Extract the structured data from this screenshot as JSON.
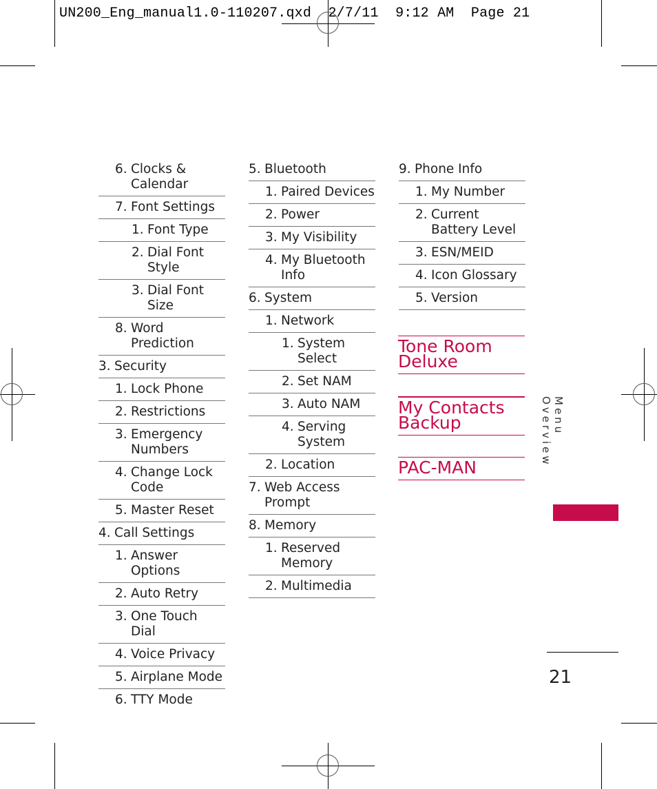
{
  "print_slug": "UN200_Eng_manual1.0-110207.qxd  2/7/11  9:12 AM  Page 21",
  "columns": [
    {
      "rows": [
        {
          "level": 1,
          "num": "6.",
          "text": "Clocks & Calendar"
        },
        {
          "level": 1,
          "num": "7.",
          "text": "Font Settings"
        },
        {
          "level": 2,
          "num": "1.",
          "text": "Font Type"
        },
        {
          "level": 2,
          "num": "2.",
          "text": "Dial Font Style"
        },
        {
          "level": 2,
          "num": "3.",
          "text": "Dial Font Size"
        },
        {
          "level": 1,
          "num": "8.",
          "text": "Word Prediction"
        },
        {
          "level": 0,
          "num": "3.",
          "text": "Security"
        },
        {
          "level": 1,
          "num": "1.",
          "text": "Lock Phone"
        },
        {
          "level": 1,
          "num": "2.",
          "text": "Restrictions"
        },
        {
          "level": 1,
          "num": "3.",
          "text": "Emergency Numbers"
        },
        {
          "level": 1,
          "num": "4.",
          "text": "Change Lock Code"
        },
        {
          "level": 1,
          "num": "5.",
          "text": "Master Reset"
        },
        {
          "level": 0,
          "num": "4.",
          "text": "Call Settings"
        },
        {
          "level": 1,
          "num": "1.",
          "text": "Answer Options"
        },
        {
          "level": 1,
          "num": "2.",
          "text": "Auto Retry"
        },
        {
          "level": 1,
          "num": "3.",
          "text": "One Touch Dial"
        },
        {
          "level": 1,
          "num": "4.",
          "text": "Voice Privacy"
        },
        {
          "level": 1,
          "num": "5.",
          "text": "Airplane Mode"
        },
        {
          "level": 1,
          "num": "6.",
          "text": "TTY Mode"
        }
      ]
    },
    {
      "rows": [
        {
          "level": 0,
          "num": "5.",
          "text": "Bluetooth"
        },
        {
          "level": 1,
          "num": "1.",
          "text": "Paired Devices"
        },
        {
          "level": 1,
          "num": "2.",
          "text": "Power"
        },
        {
          "level": 1,
          "num": "3.",
          "text": "My Visibility"
        },
        {
          "level": 1,
          "num": "4.",
          "text": "My Bluetooth Info"
        },
        {
          "level": 0,
          "num": "6.",
          "text": "System"
        },
        {
          "level": 1,
          "num": "1.",
          "text": "Network"
        },
        {
          "level": 2,
          "num": "1.",
          "text": "System Select"
        },
        {
          "level": 2,
          "num": "2.",
          "text": "Set NAM"
        },
        {
          "level": 2,
          "num": "3.",
          "text": "Auto NAM"
        },
        {
          "level": 2,
          "num": "4.",
          "text": "Serving System"
        },
        {
          "level": 1,
          "num": "2.",
          "text": "Location"
        },
        {
          "level": 0,
          "num": "7.",
          "text": "Web Access Prompt"
        },
        {
          "level": 0,
          "num": "8.",
          "text": "Memory"
        },
        {
          "level": 1,
          "num": "1.",
          "text": "Reserved Memory"
        },
        {
          "level": 1,
          "num": "2.",
          "text": "Multimedia"
        }
      ]
    },
    {
      "rows": [
        {
          "level": 0,
          "num": "9.",
          "text": "Phone Info"
        },
        {
          "level": 1,
          "num": "1.",
          "text": "My Number"
        },
        {
          "level": 1,
          "num": "2.",
          "text": "Current Battery Level"
        },
        {
          "level": 1,
          "num": "3.",
          "text": "ESN/MEID"
        },
        {
          "level": 1,
          "num": "4.",
          "text": "Icon Glossary"
        },
        {
          "level": 1,
          "num": "5.",
          "text": "Version"
        }
      ]
    }
  ],
  "apps": [
    {
      "text": "Tone Room Deluxe"
    },
    {
      "text": "My Contacts Backup"
    },
    {
      "text": "PAC-MAN"
    }
  ],
  "section_label": "Menu Overview",
  "page_number": "21",
  "accent_color": "#c60c4b"
}
